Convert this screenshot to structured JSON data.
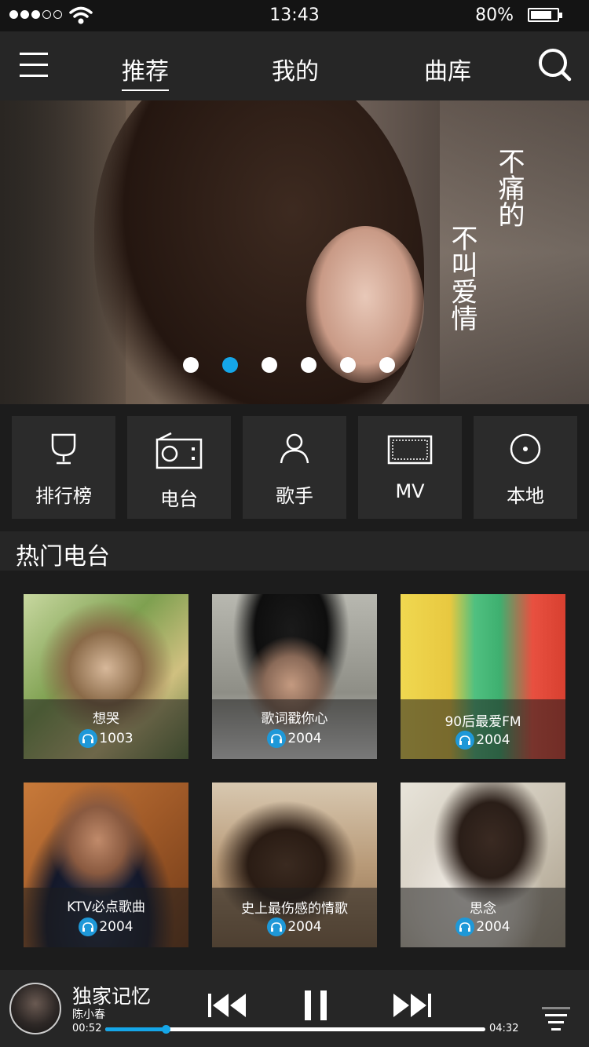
{
  "status_bar": {
    "time": "13:43",
    "battery": "80%",
    "battery_level": 0.8
  },
  "nav": {
    "tabs": [
      {
        "label": "推荐",
        "active": true
      },
      {
        "label": "我的",
        "active": false
      },
      {
        "label": "曲库",
        "active": false
      }
    ],
    "icons": [
      "menu-icon",
      "search-icon"
    ]
  },
  "banner": {
    "text_col1": "不痛的",
    "text_col2": "不叫爱情",
    "dots": 6,
    "active_dot": 2,
    "accent": "#15a6e8"
  },
  "categories": [
    {
      "label": "排行榜",
      "icon": "trophy-icon"
    },
    {
      "label": "电台",
      "icon": "radio-icon"
    },
    {
      "label": "歌手",
      "icon": "person-icon"
    },
    {
      "label": "MV",
      "icon": "film-icon"
    },
    {
      "label": "本地",
      "icon": "disc-icon"
    }
  ],
  "section": {
    "title": "热门电台"
  },
  "stations": [
    {
      "name": "想哭",
      "listeners": "1003"
    },
    {
      "name": "歌词戳你心",
      "listeners": "2004"
    },
    {
      "name": "90后最爱FM",
      "listeners": "2004"
    },
    {
      "name": "KTV必点歌曲",
      "listeners": "2004"
    },
    {
      "name": "史上最伤感的情歌",
      "listeners": "2004"
    },
    {
      "name": "思念",
      "listeners": "2004"
    }
  ],
  "player": {
    "song": "独家记忆",
    "artist": "陈小春",
    "elapsed": "00:52",
    "duration": "04:32",
    "progress": 0.16,
    "state": "playing"
  }
}
